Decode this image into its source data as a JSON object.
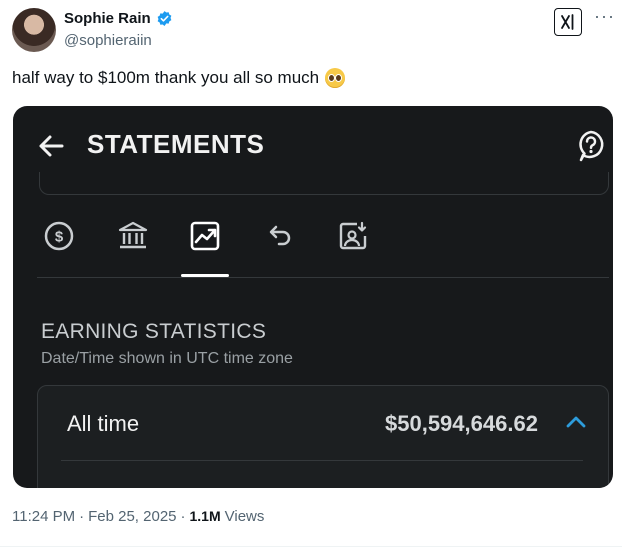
{
  "tweet": {
    "display_name": "Sophie Rain",
    "handle": "@sophieraiin",
    "text": "half way to $100m thank you all so much",
    "emoji": "pleading-face-emoji",
    "time": "11:24 PM",
    "date": "Feb 25, 2025",
    "views_count": "1.1M",
    "views_label": "Views",
    "separator": "·"
  },
  "screenshot": {
    "title": "STATEMENTS",
    "tabs": [
      {
        "icon": "dollar-circle-icon",
        "selected": false
      },
      {
        "icon": "bank-icon",
        "selected": false
      },
      {
        "icon": "chart-trending-icon",
        "selected": true
      },
      {
        "icon": "undo-arrow-icon",
        "selected": false
      },
      {
        "icon": "image-download-icon",
        "selected": false
      }
    ],
    "section_title": "EARNING STATISTICS",
    "section_subtitle": "Date/Time shown in UTC time zone",
    "all_time_label": "All time",
    "all_time_value": "$50,594,646.62"
  },
  "colors": {
    "verified_blue": "#1d9bf0",
    "chevron_blue": "#2d9cdb",
    "panel_bg": "#17191b"
  }
}
